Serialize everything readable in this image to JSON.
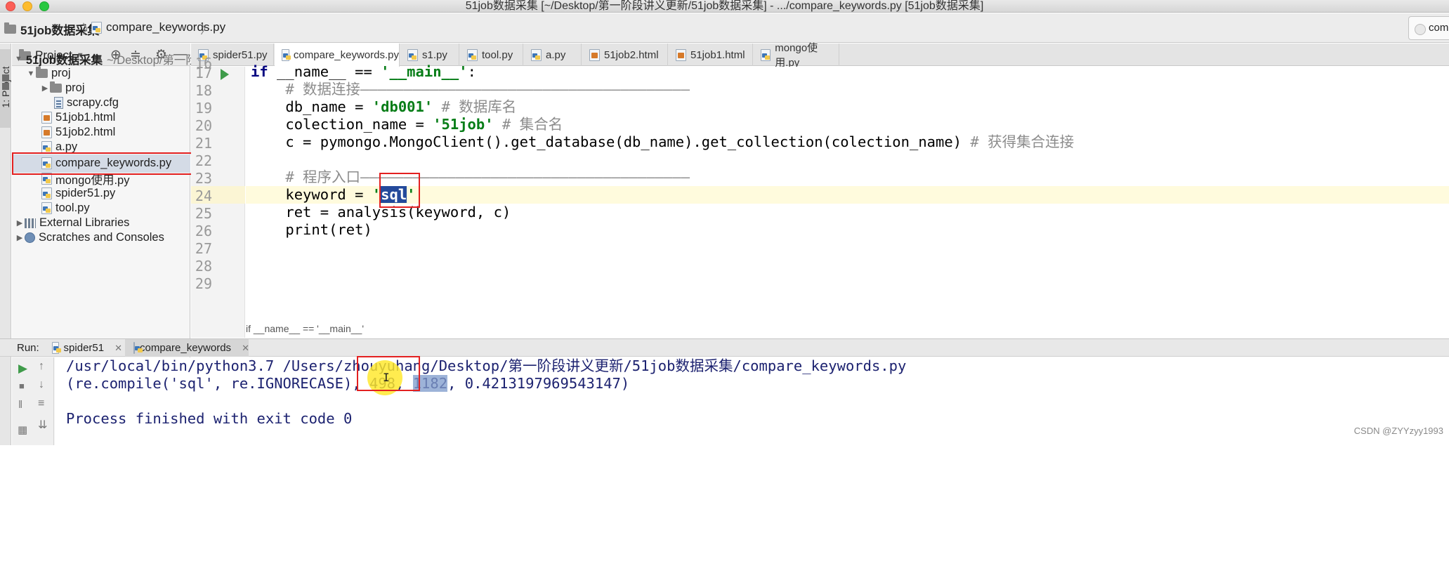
{
  "window": {
    "title": "51job数据采集 [~/Desktop/第一阶段讲义更新/51job数据采集] - .../compare_keywords.py [51job数据采集]"
  },
  "navbar": {
    "project_crumb": "51job数据采集",
    "file_crumb": "compare_keywords.py",
    "right_partial": "compo"
  },
  "left_strip": {
    "project_label": "1: Project"
  },
  "project_panel": {
    "title": "Project",
    "tree": [
      {
        "label": "51job数据采集",
        "extra": "~/Desktop/第一阶",
        "bold": true
      },
      {
        "label": "proj"
      },
      {
        "label": "proj"
      },
      {
        "label": "scrapy.cfg"
      },
      {
        "label": "51job1.html"
      },
      {
        "label": "51job2.html"
      },
      {
        "label": "a.py"
      },
      {
        "label": "compare_keywords.py",
        "selected": true
      },
      {
        "label": "mongo使用.py"
      },
      {
        "label": "spider51.py"
      },
      {
        "label": "tool.py"
      },
      {
        "label": "External Libraries"
      },
      {
        "label": "Scratches and Consoles"
      }
    ]
  },
  "tabs": [
    {
      "label": "spider51.py"
    },
    {
      "label": "compare_keywords.py",
      "active": true
    },
    {
      "label": "s1.py"
    },
    {
      "label": "tool.py"
    },
    {
      "label": "a.py"
    },
    {
      "label": "51job2.html"
    },
    {
      "label": "51job1.html"
    },
    {
      "label": "mongo使用.py"
    }
  ],
  "editor": {
    "line_numbers": [
      "16",
      "17",
      "18",
      "19",
      "20",
      "21",
      "22",
      "23",
      "24",
      "25",
      "26",
      "27",
      "28",
      "29"
    ],
    "code": {
      "l17_if": "if",
      "l17_name": " __name__ == ",
      "l17_str": "'__main__'",
      "l17_colon": ":",
      "l18": "    # 数据连接——————————————————————————————————————",
      "l19_a": "    db_name = ",
      "l19_str": "'db001'",
      "l19_cm": " # 数据库名",
      "l20_a": "    colection_name = ",
      "l20_str": "'51job'",
      "l20_cm": " # 集合名",
      "l21_a": "    c = pymongo.MongoClient().get_database(db_name).get_collection(colection_name)",
      "l21_cm": " # 获得集合连接",
      "l23": "    # 程序入口——————————————————————————————————————",
      "l24_a": "    keyword = ",
      "l24_q1": "'",
      "l24_sel": "sql",
      "l24_q2": "'",
      "l25": "    ret = analysis(keyword, c)",
      "l26": "    print(ret)"
    },
    "breadcrumb": "if __name__ == '__main__'"
  },
  "run": {
    "label": "Run:",
    "tabs": [
      {
        "label": "spider51"
      },
      {
        "label": "compare_keywords",
        "active": true
      }
    ],
    "output": {
      "line1": "/usr/local/bin/python3.7 /Users/zhouyuhang/Desktop/第一阶段讲义更新/51job数据采集/compare_keywords.py",
      "line2_a": "(re.compile('sql', re.IGNORECASE), 498, ",
      "line2_sel": "1182",
      "line2_b": ", 0.4213197969543147)",
      "line4": "Process finished with exit code 0"
    },
    "cursor_glyph": "I"
  },
  "watermark": "CSDN @ZYYzyy1993",
  "colors": {
    "highlight_box": "#e32020",
    "keyword": "#000080",
    "string": "#067d17",
    "comment": "#8c8c8c",
    "console_text": "#1c2270",
    "selection": "#244a9b",
    "cursor_highlight": "#ffe828"
  }
}
